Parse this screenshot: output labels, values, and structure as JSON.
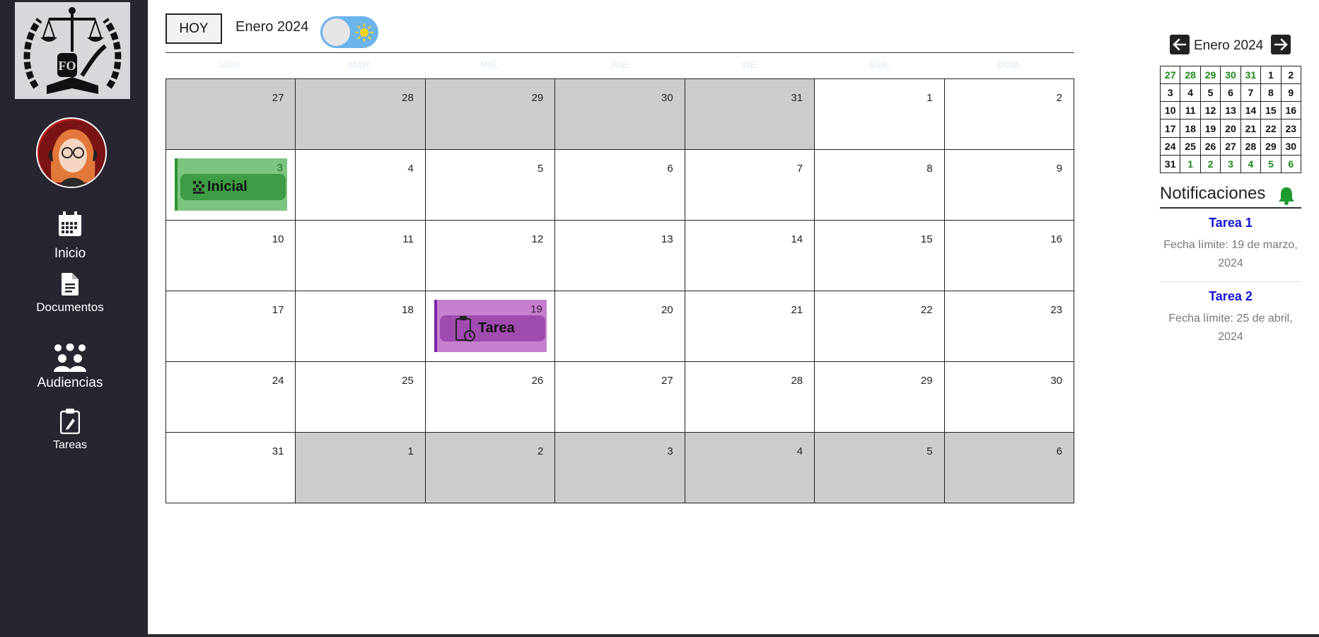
{
  "sidebar": {
    "logo": {
      "alt": "logo",
      "icon": "scales-of-justice-logo"
    },
    "avatar": {
      "icon": "user-avatar"
    },
    "items": [
      {
        "label": "Inicio",
        "icon": "calendar-icon"
      },
      {
        "label": "Documentos",
        "icon": "document-icon"
      },
      {
        "label": "Audiencias",
        "icon": "group-icon"
      },
      {
        "label": "Tareas",
        "icon": "clipboard-icon"
      }
    ]
  },
  "toolbar": {
    "today_label": "HOY",
    "month_title": "Enero 2024",
    "theme_toggle": {
      "state": "light",
      "icon": "sun-icon"
    }
  },
  "calendar": {
    "weekdays": [
      "LUN.",
      "MAR.",
      "MIÉ.",
      "JUE.",
      "VIE.",
      "SÁB.",
      "DOM."
    ],
    "weeks": [
      [
        {
          "d": "27",
          "o": true
        },
        {
          "d": "28",
          "o": true
        },
        {
          "d": "29",
          "o": true
        },
        {
          "d": "30",
          "o": true
        },
        {
          "d": "31",
          "o": true
        },
        {
          "d": "1",
          "o": false
        },
        {
          "d": "2",
          "o": false
        }
      ],
      [
        {
          "d": "3",
          "o": false
        },
        {
          "d": "4",
          "o": false
        },
        {
          "d": "5",
          "o": false
        },
        {
          "d": "6",
          "o": false
        },
        {
          "d": "7",
          "o": false
        },
        {
          "d": "8",
          "o": false
        },
        {
          "d": "9",
          "o": false
        }
      ],
      [
        {
          "d": "10",
          "o": false
        },
        {
          "d": "11",
          "o": false
        },
        {
          "d": "12",
          "o": false
        },
        {
          "d": "13",
          "o": false
        },
        {
          "d": "14",
          "o": false
        },
        {
          "d": "15",
          "o": false
        },
        {
          "d": "16",
          "o": false
        }
      ],
      [
        {
          "d": "17",
          "o": false
        },
        {
          "d": "18",
          "o": false
        },
        {
          "d": "19",
          "o": false
        },
        {
          "d": "20",
          "o": false
        },
        {
          "d": "21",
          "o": false
        },
        {
          "d": "22",
          "o": false
        },
        {
          "d": "23",
          "o": false
        }
      ],
      [
        {
          "d": "24",
          "o": false
        },
        {
          "d": "25",
          "o": false
        },
        {
          "d": "26",
          "o": false
        },
        {
          "d": "27",
          "o": false
        },
        {
          "d": "28",
          "o": false
        },
        {
          "d": "29",
          "o": false
        },
        {
          "d": "30",
          "o": false
        }
      ],
      [
        {
          "d": "31",
          "o": false
        },
        {
          "d": "1",
          "o": true
        },
        {
          "d": "2",
          "o": true
        },
        {
          "d": "3",
          "o": true
        },
        {
          "d": "4",
          "o": true
        },
        {
          "d": "5",
          "o": true
        },
        {
          "d": "6",
          "o": true
        }
      ]
    ],
    "events": [
      {
        "label": "Inicial",
        "day": "3",
        "icon": "grid-dots-icon",
        "color": "green"
      },
      {
        "label": "Tarea",
        "day": "19",
        "icon": "clipboard-clock-icon",
        "color": "purple"
      }
    ],
    "colors": {
      "other_month": "#cccccc",
      "event_green": "#3d9c44",
      "event_purple": "#a04bb0"
    }
  },
  "mini_calendar": {
    "title": "Enero 2024",
    "prev_icon": "arrow-left-icon",
    "next_icon": "arrow-right-icon",
    "weeks": [
      [
        {
          "d": "27",
          "o": true
        },
        {
          "d": "28",
          "o": true
        },
        {
          "d": "29",
          "o": true
        },
        {
          "d": "30",
          "o": true
        },
        {
          "d": "31",
          "o": true
        },
        {
          "d": "1",
          "o": false
        },
        {
          "d": "2",
          "o": false
        }
      ],
      [
        {
          "d": "3",
          "o": false
        },
        {
          "d": "4",
          "o": false
        },
        {
          "d": "5",
          "o": false
        },
        {
          "d": "6",
          "o": false
        },
        {
          "d": "7",
          "o": false
        },
        {
          "d": "8",
          "o": false
        },
        {
          "d": "9",
          "o": false
        }
      ],
      [
        {
          "d": "10",
          "o": false
        },
        {
          "d": "11",
          "o": false
        },
        {
          "d": "12",
          "o": false
        },
        {
          "d": "13",
          "o": false
        },
        {
          "d": "14",
          "o": false
        },
        {
          "d": "15",
          "o": false
        },
        {
          "d": "16",
          "o": false
        }
      ],
      [
        {
          "d": "17",
          "o": false
        },
        {
          "d": "18",
          "o": false
        },
        {
          "d": "19",
          "o": false
        },
        {
          "d": "20",
          "o": false
        },
        {
          "d": "21",
          "o": false
        },
        {
          "d": "22",
          "o": false
        },
        {
          "d": "23",
          "o": false
        }
      ],
      [
        {
          "d": "24",
          "o": false
        },
        {
          "d": "25",
          "o": false
        },
        {
          "d": "26",
          "o": false
        },
        {
          "d": "27",
          "o": false
        },
        {
          "d": "28",
          "o": false
        },
        {
          "d": "29",
          "o": false
        },
        {
          "d": "30",
          "o": false
        }
      ],
      [
        {
          "d": "31",
          "o": false
        },
        {
          "d": "1",
          "o": true
        },
        {
          "d": "2",
          "o": true
        },
        {
          "d": "3",
          "o": true
        },
        {
          "d": "4",
          "o": true
        },
        {
          "d": "5",
          "o": true
        },
        {
          "d": "6",
          "o": true
        }
      ]
    ]
  },
  "notifications": {
    "title": "Notificaciones",
    "icon": "bell-icon",
    "items": [
      {
        "title": "Tarea 1",
        "due": "Fecha límite: 19 de marzo, 2024"
      },
      {
        "title": "Tarea 2",
        "due": "Fecha límite: 25 de abril, 2024"
      }
    ]
  }
}
